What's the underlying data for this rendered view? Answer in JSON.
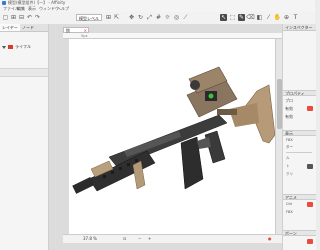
{
  "window": {
    "title": "模型(模型组件)【一】 - Affinity"
  },
  "menu": [
    "ファイル",
    "編集",
    "表示",
    "ウィンドウ",
    "ヘルプ"
  ],
  "toolbar": {
    "view_select": "模型レベル",
    "zoom": "37.8%"
  },
  "left_panel": {
    "tabs": [
      "レイヤー",
      "ノード"
    ],
    "tree": [
      {
        "label": "ライフル",
        "expanded": true
      }
    ]
  },
  "document": {
    "tab_label": "銃",
    "info": "5px",
    "zoom_status": "37.8 %"
  },
  "right_panel": {
    "header": "インスペクター",
    "sections": [
      "プロパティ",
      "表示",
      "アニメ"
    ],
    "items": [
      "プロ",
      "有効",
      "有効",
      "FBX",
      "ター",
      "ル",
      "ト",
      "クリ",
      "Ctrl",
      "FBX"
    ],
    "bottom": "ボーン"
  },
  "colors": {
    "accent": "#e74c3c",
    "badge": "#d83b2c"
  }
}
